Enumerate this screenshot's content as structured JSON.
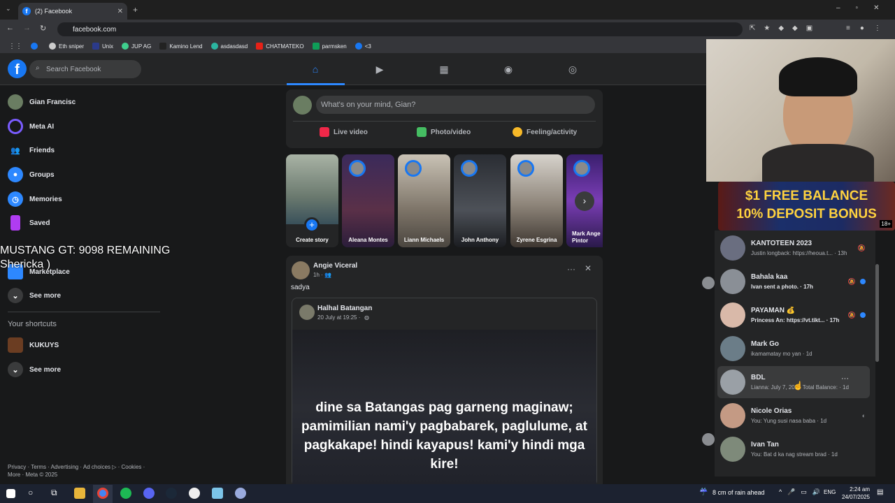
{
  "browser": {
    "tab_title": "(2) Facebook",
    "url": "facebook.com",
    "bookmarks": [
      "Eth sniper",
      "Unix",
      "JUP AG",
      "Kamino Lend",
      "asdasdasd",
      "CHATMATEKO",
      "parmsken",
      "<3"
    ]
  },
  "facebook": {
    "search_placeholder": "Search Facebook",
    "nav_icons": [
      "home-icon",
      "watch-icon",
      "marketplace-icon",
      "groups-icon",
      "gaming-icon"
    ],
    "sidebar": [
      {
        "label": "Gian Francisc",
        "icon": "profile-avatar"
      },
      {
        "label": "Meta AI",
        "icon": "meta-ai-icon"
      },
      {
        "label": "Friends",
        "icon": "friends-icon"
      },
      {
        "label": "Groups",
        "icon": "groups-icon"
      },
      {
        "label": "Memories",
        "icon": "memories-icon"
      },
      {
        "label": "Saved",
        "icon": "saved-icon"
      },
      {
        "label": "Marketplace",
        "icon": "marketplace-icon"
      },
      {
        "label": "See more",
        "icon": "chevron-down-icon"
      }
    ],
    "shortcuts_heading": "Your shortcuts",
    "shortcuts": [
      {
        "label": "KUKUYS"
      },
      {
        "label": "See more"
      }
    ],
    "footer": [
      "Privacy · Terms · Advertising · Ad choices ▷ · Cookies ·",
      "More · Meta © 2025"
    ],
    "composer": {
      "placeholder": "What's on your mind, Gian?",
      "actions": [
        "Live video",
        "Photo/video",
        "Feeling/activity"
      ]
    },
    "stories": [
      "Create story",
      "Aleana Montes",
      "Liann Michaels",
      "John Anthony",
      "Zyrene Esgrina",
      "Mark Ange Pintor"
    ],
    "post": {
      "author": "Angie Viceral",
      "time": "1h ·",
      "text": "sadya",
      "shared_author": "Halhal Batangan",
      "shared_time": "20 July at 19:25 ·",
      "shared_text": "dine sa Batangas pag garneng maginaw; pamimilian nami'y pagbabarek, paglulume, at pagkakape! hindi kayapus! kami'y hindi mga kire!"
    }
  },
  "overlay": {
    "line1": "MUSTANG GT: 9098 REMAINING",
    "line2": "Shericka  )"
  },
  "ad": {
    "line1": "$1 FREE BALANCE",
    "line2": "10% DEPOSIT BONUS",
    "badge": "18+"
  },
  "chats": [
    {
      "name": "KANTOTEEN 2023",
      "preview": "Justin longback: https://heoua.t... · 13h",
      "muted": true,
      "unread": false
    },
    {
      "name": "Bahala kaa",
      "preview": "Ivan sent a photo. · 17h",
      "muted": true,
      "unread": true
    },
    {
      "name": "PAYAMAN 💰",
      "preview": "Princess An: https://vt.tikt... · 17h",
      "muted": true,
      "unread": true
    },
    {
      "name": "Mark Go",
      "preview": "ikamamatay mo yan · 1d",
      "muted": false,
      "unread": false
    },
    {
      "name": "BDL",
      "preview": "Lianna: July 7, 2025 Total Balance: · 1d",
      "muted": false,
      "unread": false,
      "more": "···"
    },
    {
      "name": "Nicole Orias",
      "preview": "You: Yung susi nasa baba · 1d",
      "muted": false,
      "unread": false
    },
    {
      "name": "Ivan Tan",
      "preview": "You: Bat d ka nag stream brad · 1d",
      "muted": false,
      "unread": false
    }
  ],
  "taskbar": {
    "weather": "8 cm of rain ahead",
    "lang": "ENG",
    "time": "2:24 am",
    "date": "24/07/2025"
  }
}
